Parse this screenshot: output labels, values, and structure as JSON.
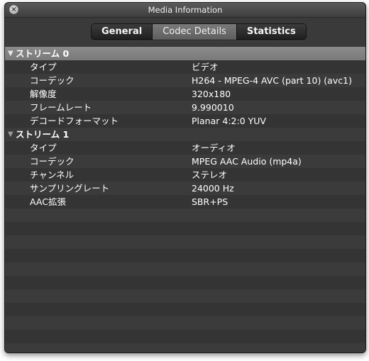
{
  "window": {
    "title": "Media Information"
  },
  "tabs": [
    {
      "label": "General"
    },
    {
      "label": "Codec Details"
    },
    {
      "label": "Statistics"
    }
  ],
  "streams": [
    {
      "label": "ストリーム 0",
      "rows": [
        {
          "key": "タイプ",
          "value": "ビデオ"
        },
        {
          "key": "コーデック",
          "value": "H264 - MPEG-4 AVC (part 10) (avc1)"
        },
        {
          "key": "解像度",
          "value": "320x180"
        },
        {
          "key": "フレームレート",
          "value": "9.990010"
        },
        {
          "key": "デコードフォーマット",
          "value": "Planar 4:2:0 YUV"
        }
      ]
    },
    {
      "label": "ストリーム 1",
      "rows": [
        {
          "key": "タイプ",
          "value": "オーディオ"
        },
        {
          "key": "コーデック",
          "value": "MPEG AAC Audio (mp4a)"
        },
        {
          "key": "チャンネル",
          "value": "ステレオ"
        },
        {
          "key": "サンプリングレート",
          "value": "24000 Hz"
        },
        {
          "key": "AAC拡張",
          "value": "SBR+PS"
        }
      ]
    }
  ]
}
